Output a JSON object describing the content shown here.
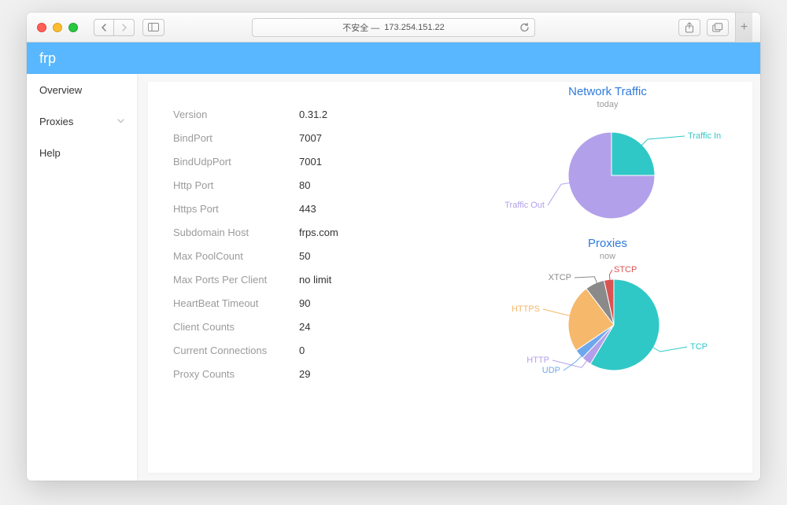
{
  "browser": {
    "address_prefix": "不安全 —",
    "address": "173.254.151.22"
  },
  "app": {
    "title": "frp"
  },
  "sidebar": {
    "items": [
      {
        "label": "Overview",
        "expandable": false
      },
      {
        "label": "Proxies",
        "expandable": true
      },
      {
        "label": "Help",
        "expandable": false
      }
    ]
  },
  "info": [
    {
      "label": "Version",
      "value": "0.31.2"
    },
    {
      "label": "BindPort",
      "value": "7007"
    },
    {
      "label": "BindUdpPort",
      "value": "7001"
    },
    {
      "label": "Http Port",
      "value": "80"
    },
    {
      "label": "Https Port",
      "value": "443"
    },
    {
      "label": "Subdomain Host",
      "value": "frps.com"
    },
    {
      "label": "Max PoolCount",
      "value": "50"
    },
    {
      "label": "Max Ports Per Client",
      "value": "no limit"
    },
    {
      "label": "HeartBeat Timeout",
      "value": "90"
    },
    {
      "label": "Client Counts",
      "value": "24"
    },
    {
      "label": "Current Connections",
      "value": "0"
    },
    {
      "label": "Proxy Counts",
      "value": "29"
    }
  ],
  "charts": {
    "traffic": {
      "title": "Network Traffic",
      "subtitle": "today",
      "labels": {
        "in": "Traffic In",
        "out": "Traffic Out"
      }
    },
    "proxies": {
      "title": "Proxies",
      "subtitle": "now",
      "labels": {
        "tcp": "TCP",
        "http": "HTTP",
        "udp": "UDP",
        "https": "HTTPS",
        "xtcp": "XTCP",
        "stcp": "STCP"
      }
    }
  },
  "chart_data": [
    {
      "type": "pie",
      "title": "Network Traffic",
      "subtitle": "today",
      "series": [
        {
          "name": "Traffic In",
          "value": 25,
          "color": "#30c8c6"
        },
        {
          "name": "Traffic Out",
          "value": 75,
          "color": "#b3a0ea"
        }
      ],
      "colors": {
        "Traffic In": "#30c8c6",
        "Traffic Out": "#b3a0ea"
      }
    },
    {
      "type": "pie",
      "title": "Proxies",
      "subtitle": "now",
      "series": [
        {
          "name": "TCP",
          "value": 17,
          "color": "#30c8c6"
        },
        {
          "name": "HTTP",
          "value": 1,
          "color": "#b3a0ea"
        },
        {
          "name": "UDP",
          "value": 1,
          "color": "#6ea8ec"
        },
        {
          "name": "HTTPS",
          "value": 7,
          "color": "#f6b86b"
        },
        {
          "name": "XTCP",
          "value": 2,
          "color": "#8a8a8a"
        },
        {
          "name": "STCP",
          "value": 1,
          "color": "#d95353"
        }
      ],
      "colors": {
        "TCP": "#30c8c6",
        "HTTP": "#b3a0ea",
        "UDP": "#6ea8ec",
        "HTTPS": "#f6b86b",
        "XTCP": "#8a8a8a",
        "STCP": "#d95353"
      }
    }
  ]
}
